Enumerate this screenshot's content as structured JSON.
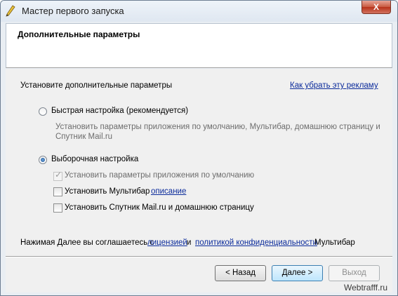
{
  "window": {
    "title": "Мастер первого запуска",
    "close_label": "X"
  },
  "header": {
    "title": "Дополнительные параметры"
  },
  "content": {
    "intro": "Установите дополнительные параметры",
    "remove_ad_link": "Как убрать эту рекламу",
    "quick_setup": {
      "label": "Быстрая настройка (рекомендуется)",
      "selected": false,
      "description_line1": "Установить параметры приложения по умолчанию, Мультибар, домашнюю страницу и",
      "description_line2": "Спутник Mail.ru"
    },
    "custom_setup": {
      "label": "Выборочная настройка",
      "selected": true,
      "options": [
        {
          "label": "Установить параметры приложения по умолчанию",
          "checked": true,
          "disabled": true
        },
        {
          "label": "Установить Мультибар",
          "link": "описание",
          "checked": false,
          "disabled": false
        },
        {
          "label": "Установить Спутник Mail.ru и домашнюю страницу",
          "checked": false,
          "disabled": false
        }
      ]
    },
    "agreement": {
      "prefix": "Нажимая Далее вы соглашаетесь с",
      "license_link": "лицензией",
      "and": "и",
      "privacy_link": "политикой конфиденциальности",
      "suffix": "Мультибар"
    }
  },
  "buttons": {
    "back": "< Назад",
    "next": "Далее >",
    "exit": "Выход"
  },
  "watermark": "Webtrafff.ru"
}
